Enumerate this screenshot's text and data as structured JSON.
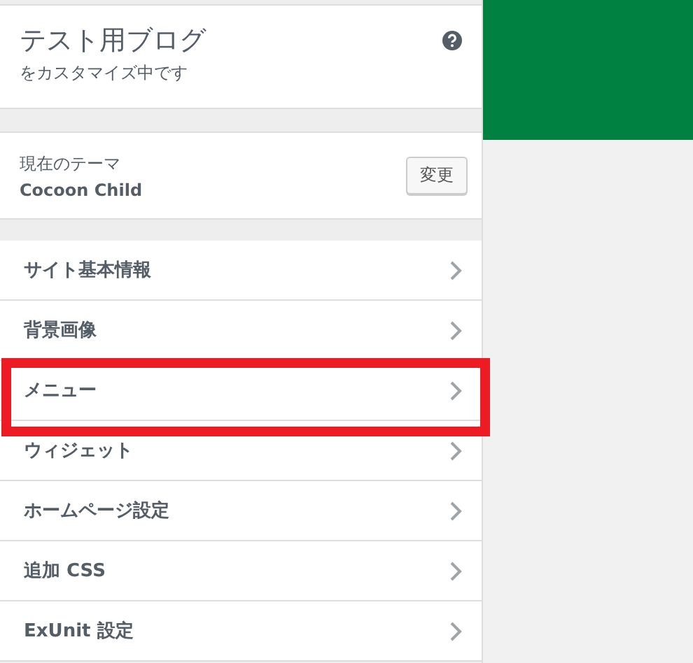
{
  "header": {
    "title": "テスト用ブログ",
    "subtitle": "をカスタマイズ中です"
  },
  "theme": {
    "label": "現在のテーマ",
    "name": "Cocoon Child",
    "button": "変更"
  },
  "sections": [
    {
      "label": "サイト基本情報",
      "highlighted": false
    },
    {
      "label": "背景画像",
      "highlighted": false
    },
    {
      "label": "メニュー",
      "highlighted": true
    },
    {
      "label": "ウィジェット",
      "highlighted": false
    },
    {
      "label": "ホームページ設定",
      "highlighted": false
    },
    {
      "label": "追加 CSS",
      "highlighted": false
    },
    {
      "label": "ExUnit 設定",
      "highlighted": false
    }
  ]
}
